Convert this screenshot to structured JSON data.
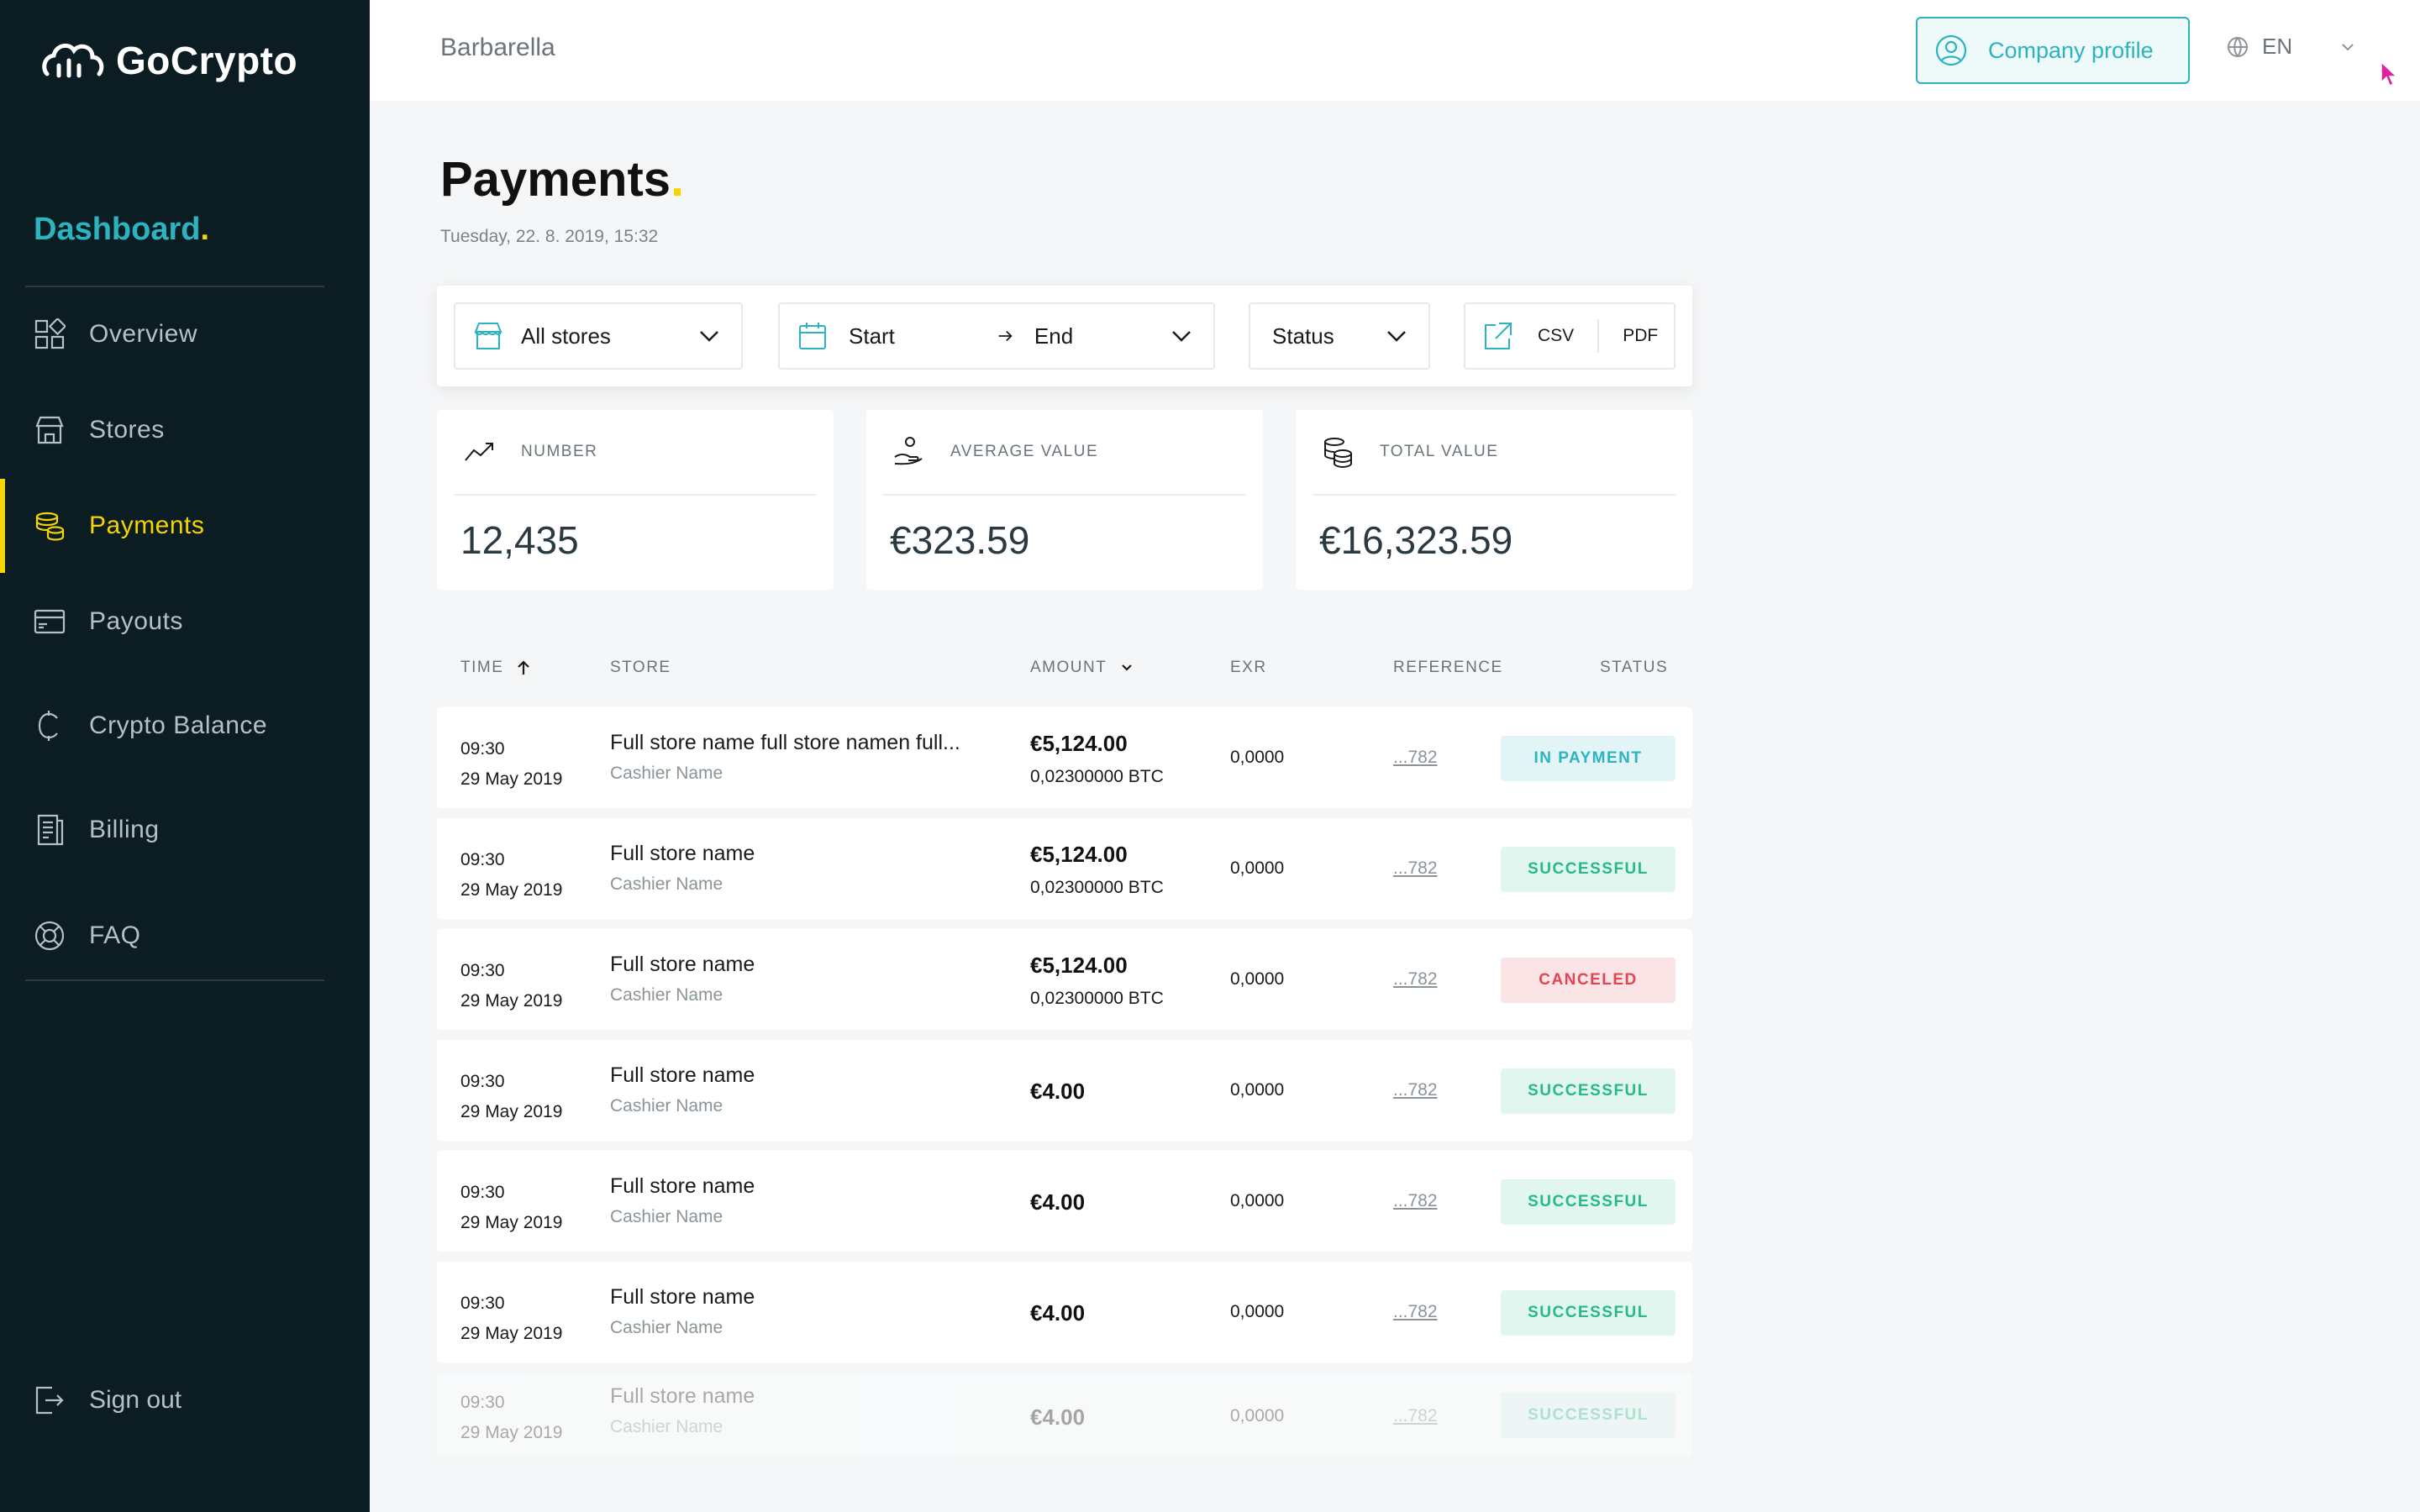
{
  "app": {
    "name": "GoCrypto",
    "section_title": "Dashboard",
    "section_dot": "."
  },
  "sidebar": {
    "items": [
      {
        "label": "Overview",
        "icon": "grid-icon"
      },
      {
        "label": "Stores",
        "icon": "store-icon"
      },
      {
        "label": "Payments",
        "icon": "coins-icon",
        "active": true
      },
      {
        "label": "Payouts",
        "icon": "card-icon"
      },
      {
        "label": "Crypto Balance",
        "icon": "crypto-icon"
      },
      {
        "label": "Billing",
        "icon": "receipt-icon"
      },
      {
        "label": "FAQ",
        "icon": "lifebuoy-icon"
      }
    ],
    "sign_out": "Sign out"
  },
  "topbar": {
    "store": "Barbarella",
    "company_profile": "Company profile",
    "language": "EN"
  },
  "page": {
    "title": "Payments",
    "title_dot": ".",
    "date": "Tuesday, 22. 8. 2019, 15:32"
  },
  "filters": {
    "stores": "All stores",
    "start": "Start",
    "end": "End",
    "status": "Status",
    "csv": "CSV",
    "pdf": "PDF"
  },
  "stats": [
    {
      "label": "NUMBER",
      "value": "12,435",
      "icon": "trend-icon"
    },
    {
      "label": "AVERAGE VALUE",
      "value": "€323.59",
      "icon": "hand-coins-icon"
    },
    {
      "label": "TOTAL VALUE",
      "value": "€16,323.59",
      "icon": "coin-stack-icon"
    }
  ],
  "table": {
    "headers": {
      "time": "TIME",
      "store": "STORE",
      "amount": "AMOUNT",
      "exr": "EXR",
      "reference": "REFERENCE",
      "status": "STATUS"
    },
    "rows": [
      {
        "time": "09:30",
        "date": "29 May 2019",
        "store": "Full store name full store namen full...",
        "cashier": "Cashier Name",
        "amount": "€5,124.00",
        "btc": "0,02300000 BTC",
        "exr": "0,0000",
        "ref": "...782",
        "status": "IN PAYMENT"
      },
      {
        "time": "09:30",
        "date": "29 May 2019",
        "store": "Full store name",
        "cashier": "Cashier Name",
        "amount": "€5,124.00",
        "btc": "0,02300000 BTC",
        "exr": "0,0000",
        "ref": "...782",
        "status": "SUCCESSFUL"
      },
      {
        "time": "09:30",
        "date": "29 May 2019",
        "store": "Full store name",
        "cashier": "Cashier Name",
        "amount": "€5,124.00",
        "btc": "0,02300000 BTC",
        "exr": "0,0000",
        "ref": "...782",
        "status": "CANCELED"
      },
      {
        "time": "09:30",
        "date": "29 May 2019",
        "store": "Full store name",
        "cashier": "Cashier Name",
        "amount": "€4.00",
        "btc": "",
        "exr": "0,0000",
        "ref": "...782",
        "status": "SUCCESSFUL"
      },
      {
        "time": "09:30",
        "date": "29 May 2019",
        "store": "Full store name",
        "cashier": "Cashier Name",
        "amount": "€4.00",
        "btc": "",
        "exr": "0,0000",
        "ref": "...782",
        "status": "SUCCESSFUL"
      },
      {
        "time": "09:30",
        "date": "29 May 2019",
        "store": "Full store name",
        "cashier": "Cashier Name",
        "amount": "€4.00",
        "btc": "",
        "exr": "0,0000",
        "ref": "...782",
        "status": "SUCCESSFUL"
      },
      {
        "time": "09:30",
        "date": "29 May 2019",
        "store": "Full store name",
        "cashier": "Cashier Name",
        "amount": "€4.00",
        "btc": "",
        "exr": "0,0000",
        "ref": "...782",
        "status": "SUCCESSFUL"
      }
    ]
  },
  "colors": {
    "accent": "#2bb4c0",
    "highlight": "#f5d400",
    "sidebar_bg": "#0b1d23",
    "success": "#27b88b",
    "danger": "#e04652"
  }
}
